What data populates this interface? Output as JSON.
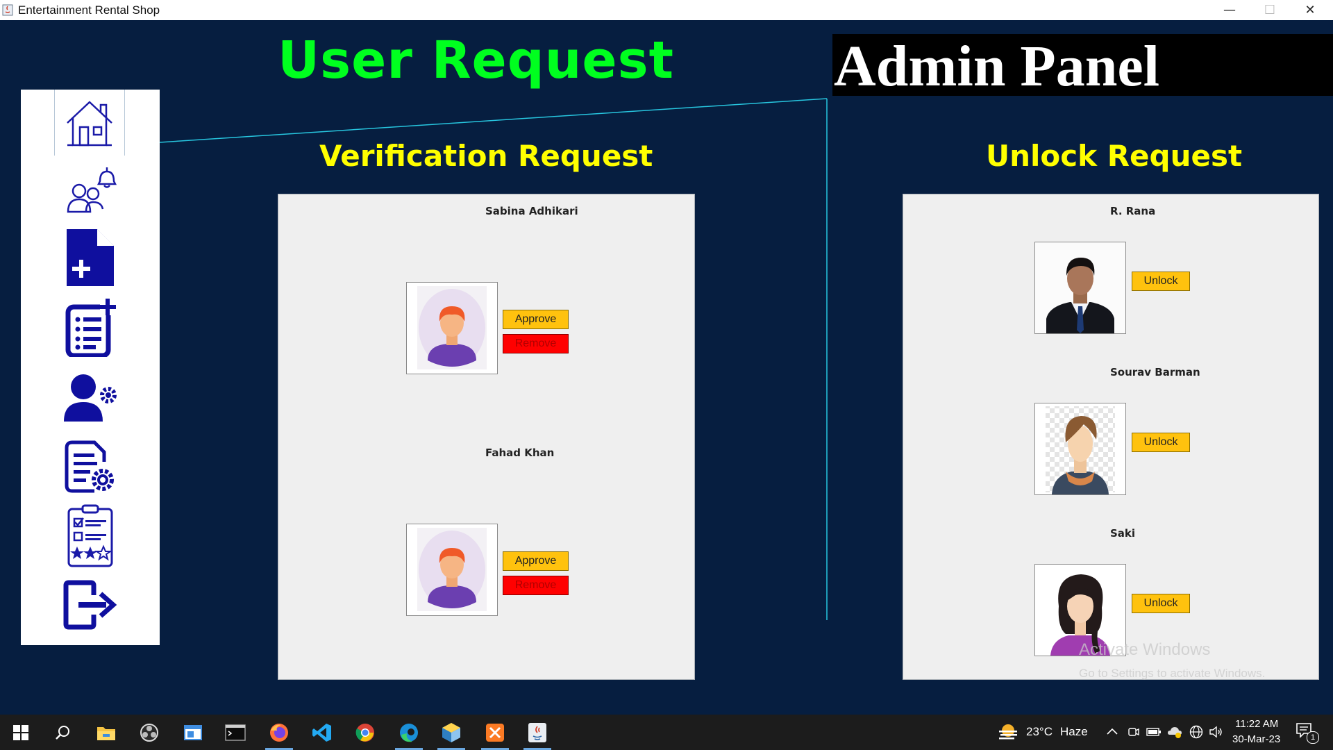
{
  "window": {
    "title": "Entertainment Rental Shop",
    "minimize": "—",
    "maximize": "☐",
    "close": "✕"
  },
  "header": {
    "title": "User Request",
    "admin_label": "Admin Panel"
  },
  "sidebar": {
    "items": [
      "home-icon",
      "user-notification-icon",
      "add-file-icon",
      "add-list-icon",
      "user-settings-icon",
      "document-settings-icon",
      "checklist-rating-icon",
      "logout-icon"
    ]
  },
  "verification": {
    "title": "Verification Request",
    "requests": [
      {
        "name": "Sabina Adhikari",
        "approve_label": "Approve",
        "remove_label": "Remove"
      },
      {
        "name": "Fahad Khan",
        "approve_label": "Approve",
        "remove_label": "Remove"
      }
    ]
  },
  "unlock": {
    "title": "Unlock Request",
    "requests": [
      {
        "name": "R. Rana",
        "unlock_label": "Unlock"
      },
      {
        "name": "Sourav Barman",
        "unlock_label": "Unlock"
      },
      {
        "name": "Saki",
        "unlock_label": "Unlock"
      }
    ]
  },
  "watermark": {
    "line1": "Activate Windows",
    "line2": "Go to Settings to activate Windows."
  },
  "taskbar": {
    "apps": [
      "windows-start-icon",
      "search-icon",
      "file-explorer-icon",
      "obs-icon",
      "notes-icon",
      "terminal-icon",
      "firefox-icon",
      "vscode-icon",
      "chrome-icon",
      "edge-icon",
      "virtualbox-icon",
      "xampp-icon",
      "java-icon"
    ],
    "weather": {
      "temp": "23°C",
      "condition": "Haze"
    },
    "clock": {
      "time": "11:22 AM",
      "date": "30-Mar-23"
    },
    "notification_count": "1"
  },
  "colors": {
    "background": "#061e40",
    "title_green": "#00ff1f",
    "section_yellow": "#ffff00",
    "approve": "#ffc20e",
    "remove": "#ff0000",
    "icon_navy": "#0f0f9e"
  }
}
